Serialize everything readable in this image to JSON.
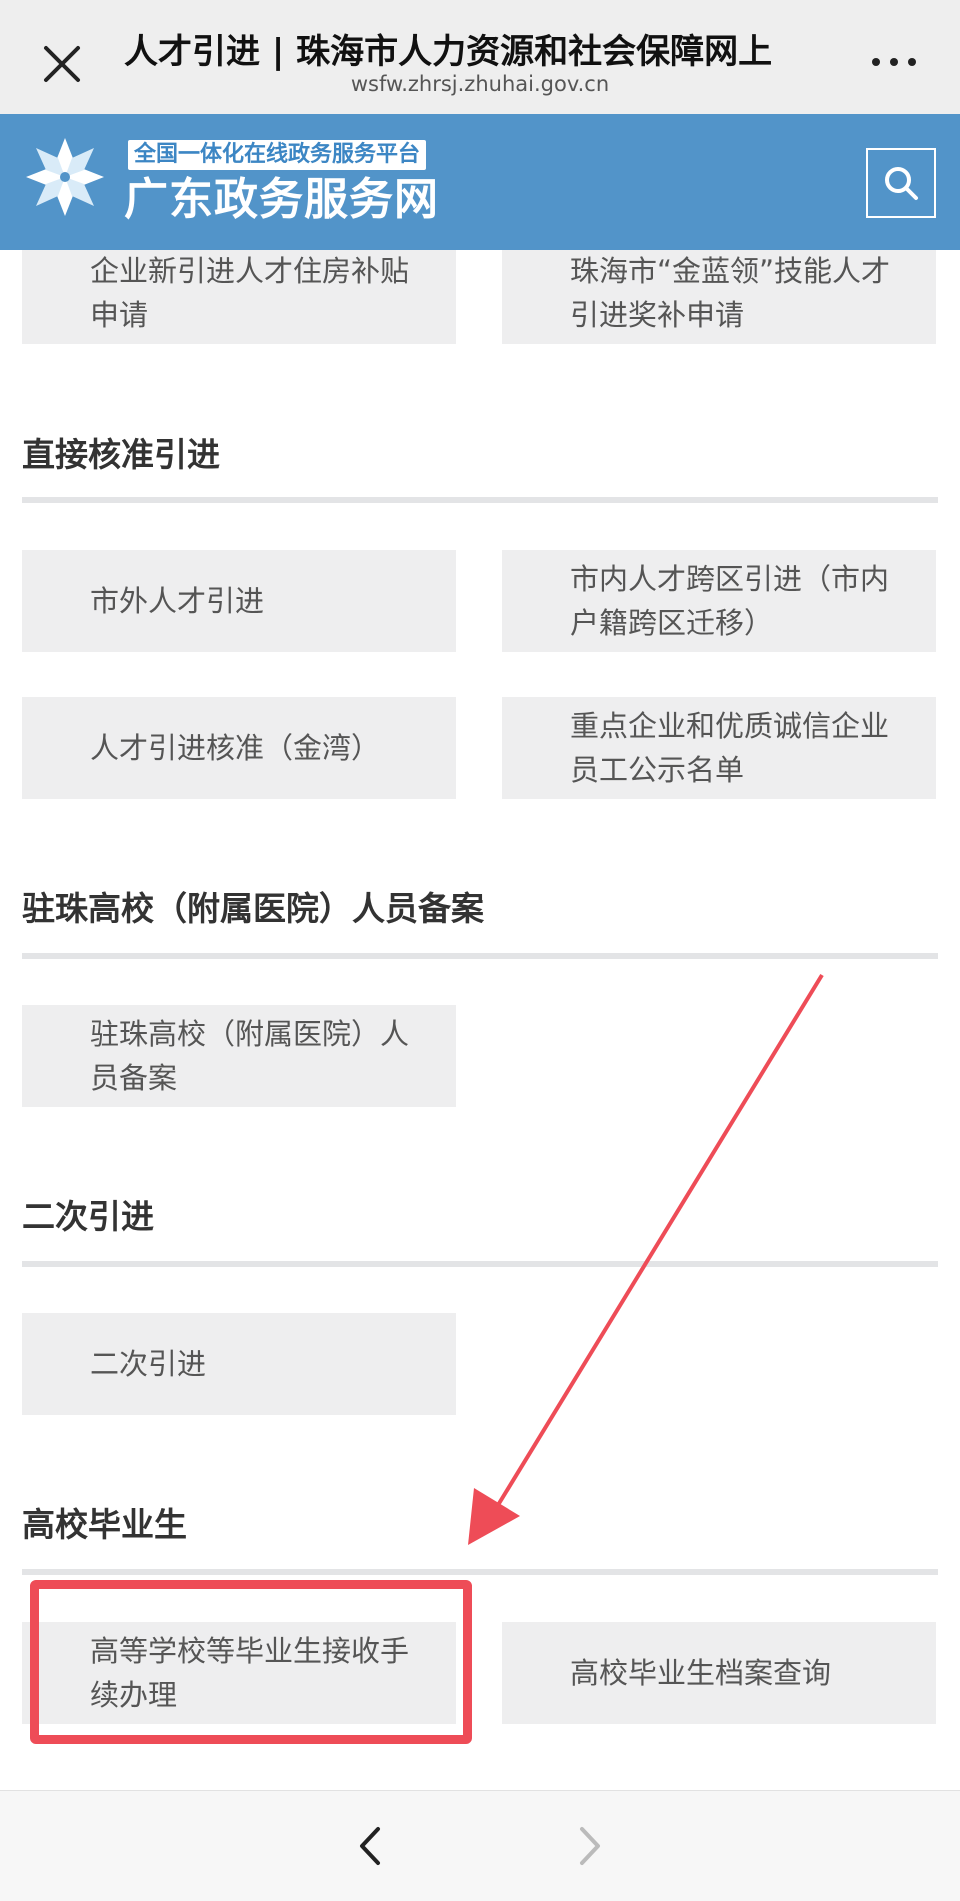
{
  "browser": {
    "title": "人才引进 | 珠海市人力资源和社会保障网上",
    "url": "wsfw.zhrsj.zhuhai.gov.cn"
  },
  "site_header": {
    "brand_sub": "全国一体化在线政务服务平台",
    "brand_main": "广东政务服务网"
  },
  "cards_top": [
    {
      "label": "企业新引进人才住房补贴申请"
    },
    {
      "label": "珠海市“金蓝领”技能人才引进奖补申请"
    }
  ],
  "sections": [
    {
      "title": "直接核准引进",
      "cards": [
        {
          "label": "市外人才引进"
        },
        {
          "label": "市内人才跨区引进（市内户籍跨区迁移）"
        },
        {
          "label": "人才引进核准（金湾）"
        },
        {
          "label": "重点企业和优质诚信企业员工公示名单"
        }
      ]
    },
    {
      "title": "驻珠高校（附属医院）人员备案",
      "cards": [
        {
          "label": "驻珠高校（附属医院）人员备案"
        }
      ]
    },
    {
      "title": "二次引进",
      "cards": [
        {
          "label": "二次引进"
        }
      ]
    },
    {
      "title": "高校毕业生",
      "cards": [
        {
          "label": "高等学校等毕业生接收手续办理"
        },
        {
          "label": "高校毕业生档案查询"
        }
      ]
    }
  ],
  "colors": {
    "header_bg": "#5294c9",
    "card_bg": "#eeeeef",
    "annotation_red": "#ee4c57"
  }
}
